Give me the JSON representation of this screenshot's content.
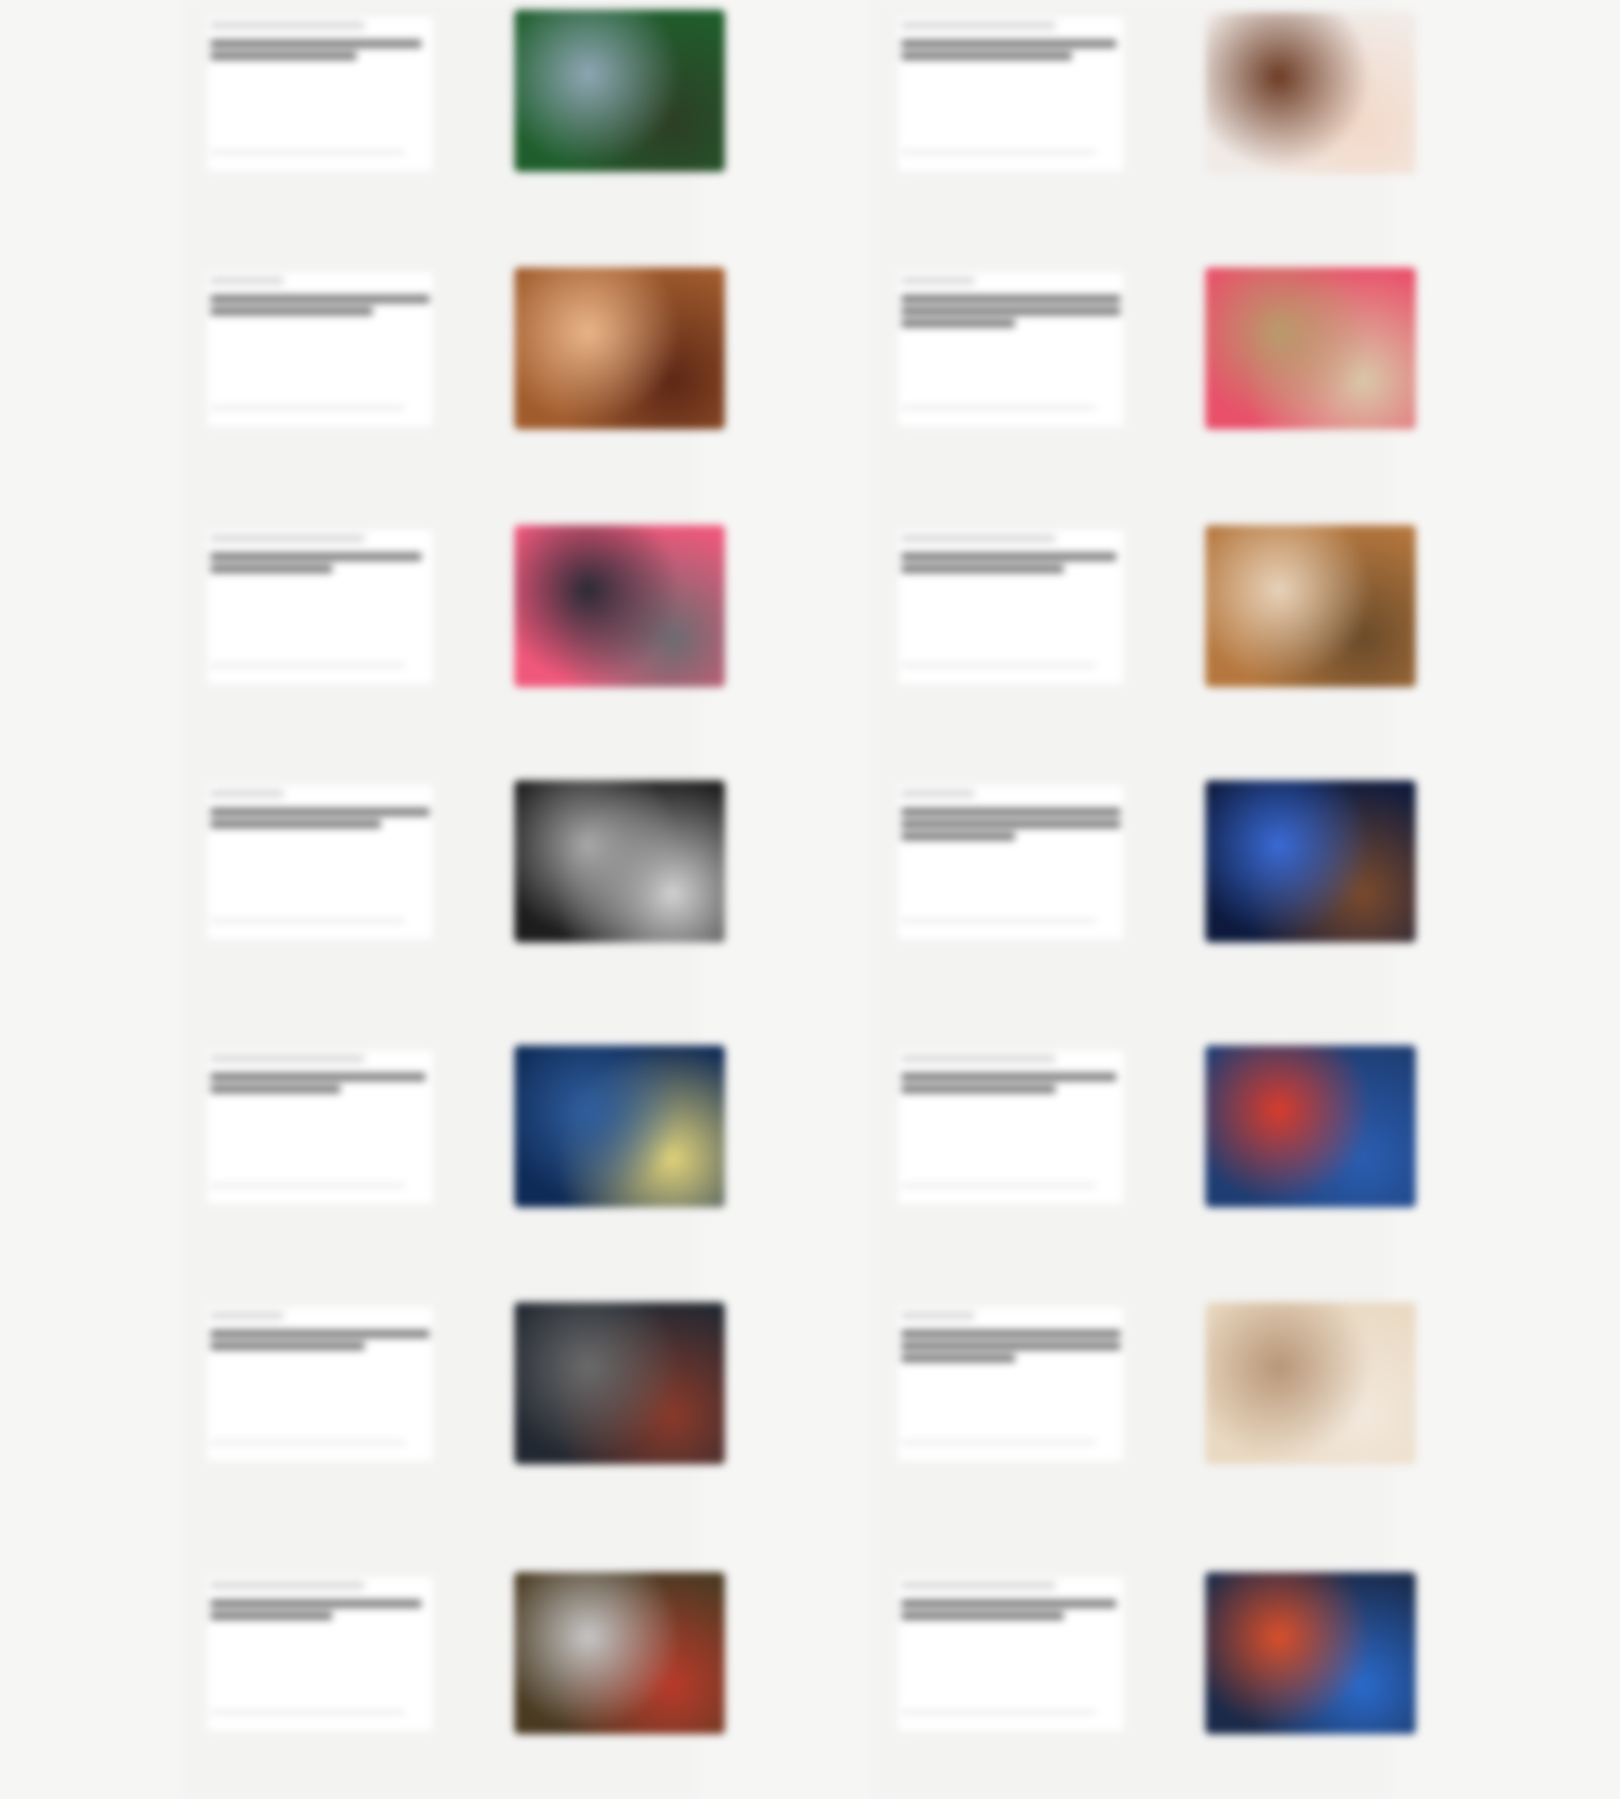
{
  "cards": [
    {
      "id": "l1",
      "colors": [
        "#1f5e2c",
        "#8fa6b5",
        "#2d3e24"
      ]
    },
    {
      "id": "r1",
      "colors": [
        "#f1ebe7",
        "#6b3a23",
        "#f3d9c9"
      ]
    },
    {
      "id": "l2",
      "colors": [
        "#a15c2d",
        "#e9b58a",
        "#5c2716"
      ]
    },
    {
      "id": "r2",
      "colors": [
        "#e9506a",
        "#b89b6b",
        "#d9c9a8"
      ]
    },
    {
      "id": "l3",
      "colors": [
        "#f0587b",
        "#2a2a36",
        "#6b6b70"
      ]
    },
    {
      "id": "r3",
      "colors": [
        "#b5773e",
        "#e8d3ba",
        "#6a4b2a"
      ]
    },
    {
      "id": "l4",
      "colors": [
        "#1d1d1d",
        "#a9a9a9",
        "#d2d2d2"
      ]
    },
    {
      "id": "r4",
      "colors": [
        "#0d1a3d",
        "#3a6bd6",
        "#7a4a2c"
      ]
    },
    {
      "id": "l5",
      "colors": [
        "#0e2a56",
        "#2f5e9e",
        "#e0d27a"
      ]
    },
    {
      "id": "r5",
      "colors": [
        "#1e3d73",
        "#d83c2c",
        "#2a5db0"
      ]
    },
    {
      "id": "l6",
      "colors": [
        "#222831",
        "#6b6b6b",
        "#8a3a2a"
      ]
    },
    {
      "id": "r6",
      "colors": [
        "#e9d9c2",
        "#b89677",
        "#f2e8dc"
      ]
    },
    {
      "id": "l7",
      "colors": [
        "#4a3a22",
        "#c7c7c7",
        "#b83a2a"
      ]
    },
    {
      "id": "r7",
      "colors": [
        "#1a2a4a",
        "#d94f2a",
        "#2a6acb"
      ]
    }
  ]
}
